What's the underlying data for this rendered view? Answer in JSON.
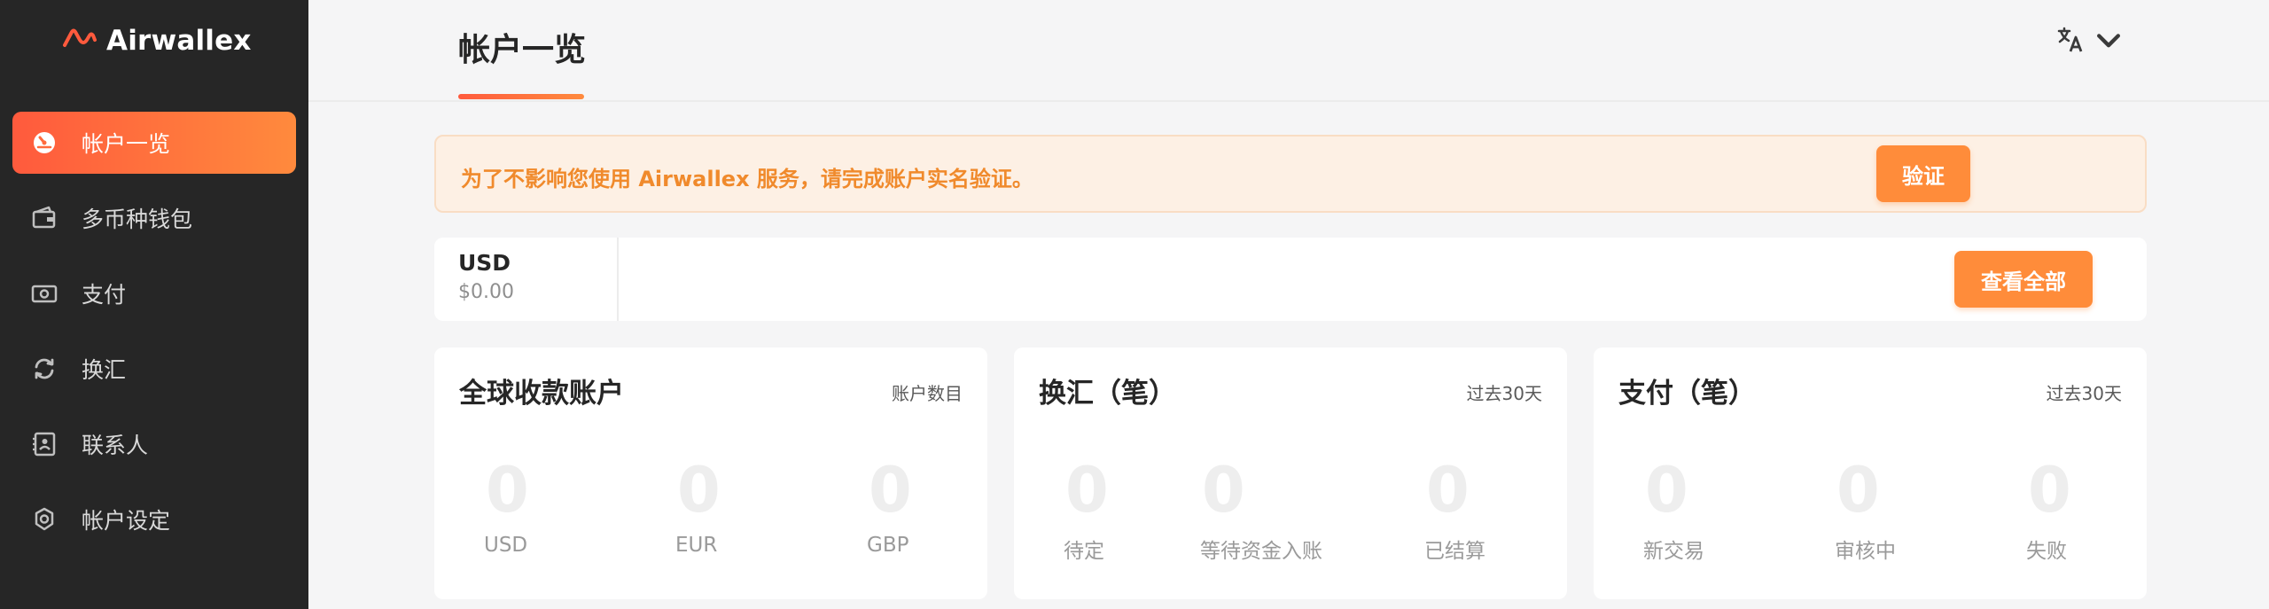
{
  "brand": {
    "name": "Airwallex",
    "accent": "#ff5a3d",
    "accent_light": "#ff8a3d"
  },
  "sidebar": {
    "items": [
      {
        "label": "帐户一览",
        "icon": "dashboard-gauge-icon",
        "active": true
      },
      {
        "label": "多币种钱包",
        "icon": "wallet-icon",
        "active": false
      },
      {
        "label": "支付",
        "icon": "banknote-icon",
        "active": false
      },
      {
        "label": "换汇",
        "icon": "exchange-refresh-icon",
        "active": false
      },
      {
        "label": "联系人",
        "icon": "contacts-book-icon",
        "active": false
      },
      {
        "label": "帐户设定",
        "icon": "gear-icon",
        "active": false
      }
    ]
  },
  "header": {
    "title": "帐户一览",
    "language_icon": "translate-icon"
  },
  "notice": {
    "text": "为了不影响您使用 Airwallex 服务，请完成账户实名验证。",
    "button_label": "验证"
  },
  "balance": {
    "currency": "USD",
    "amount": "$0.00",
    "view_all_label": "查看全部"
  },
  "cards": [
    {
      "title": "全球收款账户",
      "meta": "账户数目",
      "stats": [
        {
          "value": "0",
          "label": "USD"
        },
        {
          "value": "0",
          "label": "EUR"
        },
        {
          "value": "0",
          "label": "GBP"
        }
      ]
    },
    {
      "title": "换汇（笔）",
      "meta": "过去30天",
      "stats": [
        {
          "value": "0",
          "label": "待定"
        },
        {
          "value": "0",
          "label": "等待资金入账"
        },
        {
          "value": "0",
          "label": "已结算"
        }
      ]
    },
    {
      "title": "支付（笔）",
      "meta": "过去30天",
      "stats": [
        {
          "value": "0",
          "label": "新交易"
        },
        {
          "value": "0",
          "label": "审核中"
        },
        {
          "value": "0",
          "label": "失败"
        }
      ]
    }
  ]
}
